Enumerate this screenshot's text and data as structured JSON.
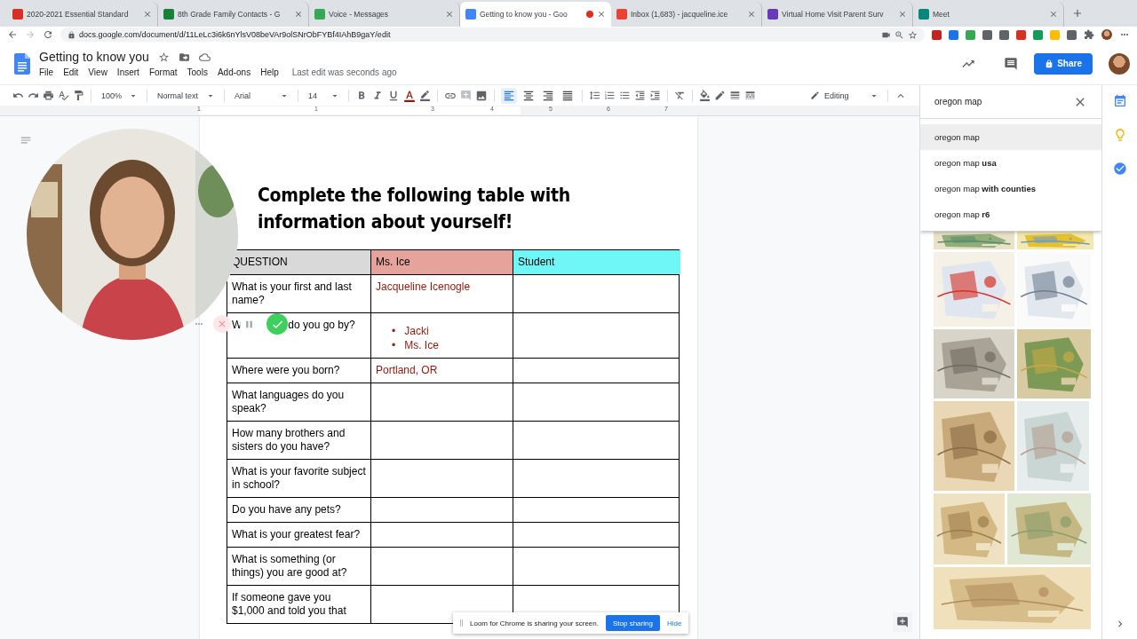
{
  "browser": {
    "tabs": [
      {
        "title": "2020-2021 Essential Standard",
        "selected": false,
        "recording": false,
        "color": "#d93025"
      },
      {
        "title": "8th Grade Family Contacts - G",
        "selected": false,
        "recording": false,
        "color": "#188038"
      },
      {
        "title": "Voice - Messages",
        "selected": false,
        "recording": false,
        "color": "#34a853"
      },
      {
        "title": "Getting to know you - Goo",
        "selected": true,
        "recording": true,
        "color": "#4285f4"
      },
      {
        "title": "Inbox (1,683) - jacqueline.ice",
        "selected": false,
        "recording": false,
        "color": "#ea4335"
      },
      {
        "title": "Virtual Home Visit Parent Surv",
        "selected": false,
        "recording": false,
        "color": "#673ab7"
      },
      {
        "title": "Meet",
        "selected": false,
        "recording": false,
        "color": "#00897b"
      }
    ],
    "url": "docs.google.com/document/d/11LeLc3i6k6nYlsV08beVAr9olSNrObFYBf4IAhB9gaY/edit"
  },
  "docs": {
    "title": "Getting to know you",
    "menu": [
      "File",
      "Edit",
      "View",
      "Insert",
      "Format",
      "Tools",
      "Add-ons",
      "Help"
    ],
    "last_edit": "Last edit was seconds ago",
    "share": "Share"
  },
  "toolbar": {
    "zoom": "100%",
    "style": "Normal text",
    "font": "Arial",
    "size": "14",
    "align": [
      {
        "selected": true
      },
      {
        "selected": false
      },
      {
        "selected": false
      },
      {
        "selected": false
      }
    ],
    "mode": "Editing"
  },
  "ruler": [
    "1",
    "1",
    "3",
    "4",
    "5",
    "6",
    "7"
  ],
  "webcam": {
    "kind": "picture"
  },
  "document": {
    "heading": "Complete the following table with information about yourself!",
    "columns": [
      {
        "label": "QUESTION",
        "color": "#d9d9d9"
      },
      {
        "label": "Ms. Ice",
        "color": "#e6a39c"
      },
      {
        "label": "Student",
        "color": "#6ff7f7"
      }
    ],
    "rows": [
      {
        "question": "What is your first and last name?",
        "answer": {
          "kind": "text",
          "text": "Jacqueline Icenogle"
        }
      },
      {
        "question": "W",
        "question_end": "do you go by?",
        "answer": {
          "kind": "list",
          "marker": "•",
          "items": [
            "Jacki",
            "Ms. Ice"
          ]
        }
      },
      {
        "question": "Where were you born?",
        "answer": {
          "kind": "text",
          "text": "Portland, OR"
        }
      },
      {
        "question": "What languages do you speak?"
      },
      {
        "question": "How many brothers and sisters do you have?"
      },
      {
        "question": "What is your favorite subject in school?"
      },
      {
        "question": "Do you have any pets?"
      },
      {
        "question": "What is your greatest fear?"
      },
      {
        "question": "What is something (or things) you are good at?"
      },
      {
        "question": "If someone gave you $1,000 and told you that"
      }
    ]
  },
  "recorder_bar": {
    "message": "Loom for Chrome is sharing your screen.",
    "stop": "Stop sharing",
    "hide": "Hide"
  },
  "search_panel": {
    "query": "oregon map",
    "suggestions": [
      {
        "text": "oregon map",
        "selected": true
      },
      {
        "text": "oregon map **usa**",
        "selected": false
      },
      {
        "text": "oregon map **with counties**",
        "selected": false
      },
      {
        "text": "oregon map **r6**",
        "selected": false
      }
    ],
    "image_results": [
      {
        "kind": "picture"
      },
      {
        "kind": "picture"
      },
      {
        "kind": "picture"
      },
      {
        "kind": "picture"
      },
      {
        "kind": "picture"
      },
      {
        "kind": "picture"
      },
      {
        "kind": "picture"
      },
      {
        "kind": "picture"
      },
      {
        "kind": "picture"
      },
      {
        "kind": "picture"
      },
      {
        "kind": "picture"
      }
    ]
  }
}
